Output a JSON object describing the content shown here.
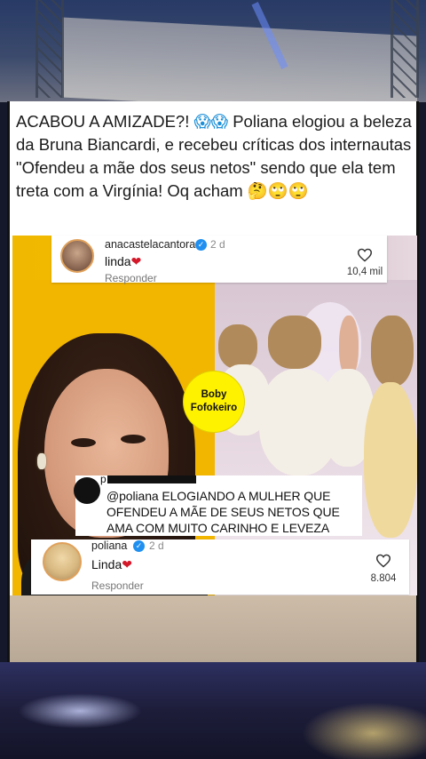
{
  "post": {
    "caption_part1": "ACABOU A AMIZADE?! ",
    "caption_emoji1": "😱😱",
    "caption_part2": " Poliana elogiou a beleza da Bruna Biancardi, e recebeu críticas dos internautas \"Ofendeu a mãe dos seus netos\" sendo que ela tem treta com a Virgínia! Oq acham ",
    "caption_emoji2": "🤔🙄🙄"
  },
  "comment_top": {
    "username": "anacastelacantora",
    "verified_icon": "✓",
    "time": "2 d",
    "text": "linda",
    "heart": "❤",
    "reply_label": "Responder",
    "likes": "10,4 mil"
  },
  "badge": {
    "line1": "Boby",
    "line2": "Fofokeiro"
  },
  "comment_mid": {
    "initial": "p",
    "text": "@poliana ELOGIANDO A MULHER QUE OFENDEU A MÃE DE SEUS NETOS QUE AMA COM MUITO CARINHO E LEVEZA"
  },
  "comment_bottom": {
    "username": "poliana",
    "verified_icon": "✓",
    "time": "2 d",
    "text": "Linda",
    "heart": "❤",
    "reply_label": "Responder",
    "likes": "8.804"
  },
  "icons": {
    "like": "heart-outline-icon",
    "verified": "verified-badge-icon"
  },
  "colors": {
    "verified_blue": "#1f8ff0",
    "badge_yellow": "#fff200",
    "heart_red": "#d4182a"
  }
}
